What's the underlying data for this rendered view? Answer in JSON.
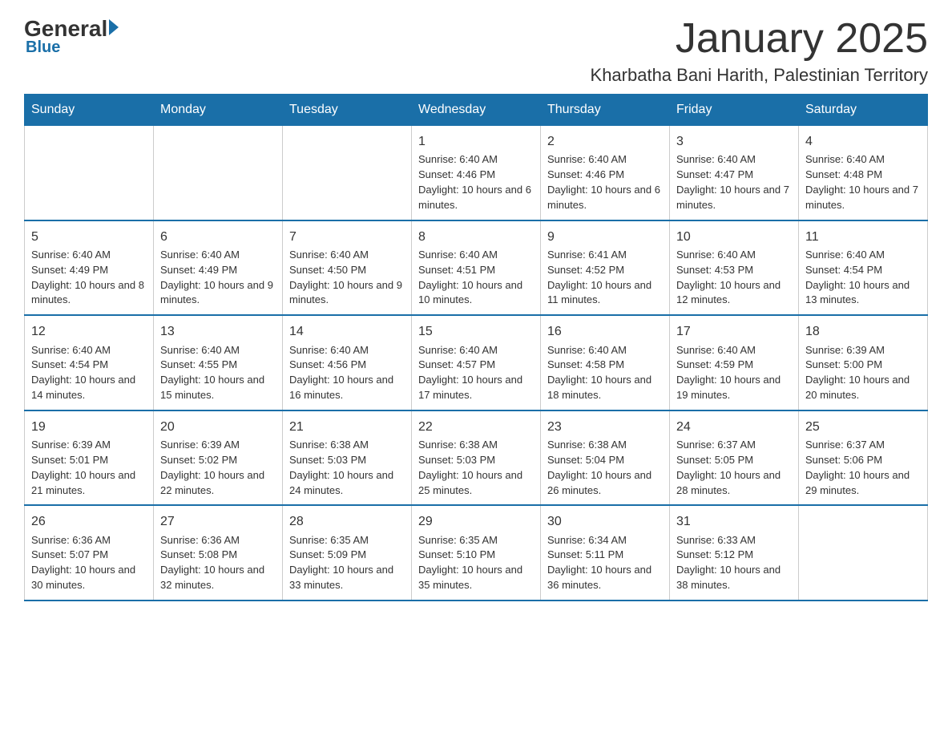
{
  "logo": {
    "general": "General",
    "blue": "Blue"
  },
  "header": {
    "month": "January 2025",
    "location": "Kharbatha Bani Harith, Palestinian Territory"
  },
  "days_of_week": [
    "Sunday",
    "Monday",
    "Tuesday",
    "Wednesday",
    "Thursday",
    "Friday",
    "Saturday"
  ],
  "weeks": [
    [
      {
        "day": "",
        "info": ""
      },
      {
        "day": "",
        "info": ""
      },
      {
        "day": "",
        "info": ""
      },
      {
        "day": "1",
        "info": "Sunrise: 6:40 AM\nSunset: 4:46 PM\nDaylight: 10 hours and 6 minutes."
      },
      {
        "day": "2",
        "info": "Sunrise: 6:40 AM\nSunset: 4:46 PM\nDaylight: 10 hours and 6 minutes."
      },
      {
        "day": "3",
        "info": "Sunrise: 6:40 AM\nSunset: 4:47 PM\nDaylight: 10 hours and 7 minutes."
      },
      {
        "day": "4",
        "info": "Sunrise: 6:40 AM\nSunset: 4:48 PM\nDaylight: 10 hours and 7 minutes."
      }
    ],
    [
      {
        "day": "5",
        "info": "Sunrise: 6:40 AM\nSunset: 4:49 PM\nDaylight: 10 hours and 8 minutes."
      },
      {
        "day": "6",
        "info": "Sunrise: 6:40 AM\nSunset: 4:49 PM\nDaylight: 10 hours and 9 minutes."
      },
      {
        "day": "7",
        "info": "Sunrise: 6:40 AM\nSunset: 4:50 PM\nDaylight: 10 hours and 9 minutes."
      },
      {
        "day": "8",
        "info": "Sunrise: 6:40 AM\nSunset: 4:51 PM\nDaylight: 10 hours and 10 minutes."
      },
      {
        "day": "9",
        "info": "Sunrise: 6:41 AM\nSunset: 4:52 PM\nDaylight: 10 hours and 11 minutes."
      },
      {
        "day": "10",
        "info": "Sunrise: 6:40 AM\nSunset: 4:53 PM\nDaylight: 10 hours and 12 minutes."
      },
      {
        "day": "11",
        "info": "Sunrise: 6:40 AM\nSunset: 4:54 PM\nDaylight: 10 hours and 13 minutes."
      }
    ],
    [
      {
        "day": "12",
        "info": "Sunrise: 6:40 AM\nSunset: 4:54 PM\nDaylight: 10 hours and 14 minutes."
      },
      {
        "day": "13",
        "info": "Sunrise: 6:40 AM\nSunset: 4:55 PM\nDaylight: 10 hours and 15 minutes."
      },
      {
        "day": "14",
        "info": "Sunrise: 6:40 AM\nSunset: 4:56 PM\nDaylight: 10 hours and 16 minutes."
      },
      {
        "day": "15",
        "info": "Sunrise: 6:40 AM\nSunset: 4:57 PM\nDaylight: 10 hours and 17 minutes."
      },
      {
        "day": "16",
        "info": "Sunrise: 6:40 AM\nSunset: 4:58 PM\nDaylight: 10 hours and 18 minutes."
      },
      {
        "day": "17",
        "info": "Sunrise: 6:40 AM\nSunset: 4:59 PM\nDaylight: 10 hours and 19 minutes."
      },
      {
        "day": "18",
        "info": "Sunrise: 6:39 AM\nSunset: 5:00 PM\nDaylight: 10 hours and 20 minutes."
      }
    ],
    [
      {
        "day": "19",
        "info": "Sunrise: 6:39 AM\nSunset: 5:01 PM\nDaylight: 10 hours and 21 minutes."
      },
      {
        "day": "20",
        "info": "Sunrise: 6:39 AM\nSunset: 5:02 PM\nDaylight: 10 hours and 22 minutes."
      },
      {
        "day": "21",
        "info": "Sunrise: 6:38 AM\nSunset: 5:03 PM\nDaylight: 10 hours and 24 minutes."
      },
      {
        "day": "22",
        "info": "Sunrise: 6:38 AM\nSunset: 5:03 PM\nDaylight: 10 hours and 25 minutes."
      },
      {
        "day": "23",
        "info": "Sunrise: 6:38 AM\nSunset: 5:04 PM\nDaylight: 10 hours and 26 minutes."
      },
      {
        "day": "24",
        "info": "Sunrise: 6:37 AM\nSunset: 5:05 PM\nDaylight: 10 hours and 28 minutes."
      },
      {
        "day": "25",
        "info": "Sunrise: 6:37 AM\nSunset: 5:06 PM\nDaylight: 10 hours and 29 minutes."
      }
    ],
    [
      {
        "day": "26",
        "info": "Sunrise: 6:36 AM\nSunset: 5:07 PM\nDaylight: 10 hours and 30 minutes."
      },
      {
        "day": "27",
        "info": "Sunrise: 6:36 AM\nSunset: 5:08 PM\nDaylight: 10 hours and 32 minutes."
      },
      {
        "day": "28",
        "info": "Sunrise: 6:35 AM\nSunset: 5:09 PM\nDaylight: 10 hours and 33 minutes."
      },
      {
        "day": "29",
        "info": "Sunrise: 6:35 AM\nSunset: 5:10 PM\nDaylight: 10 hours and 35 minutes."
      },
      {
        "day": "30",
        "info": "Sunrise: 6:34 AM\nSunset: 5:11 PM\nDaylight: 10 hours and 36 minutes."
      },
      {
        "day": "31",
        "info": "Sunrise: 6:33 AM\nSunset: 5:12 PM\nDaylight: 10 hours and 38 minutes."
      },
      {
        "day": "",
        "info": ""
      }
    ]
  ]
}
